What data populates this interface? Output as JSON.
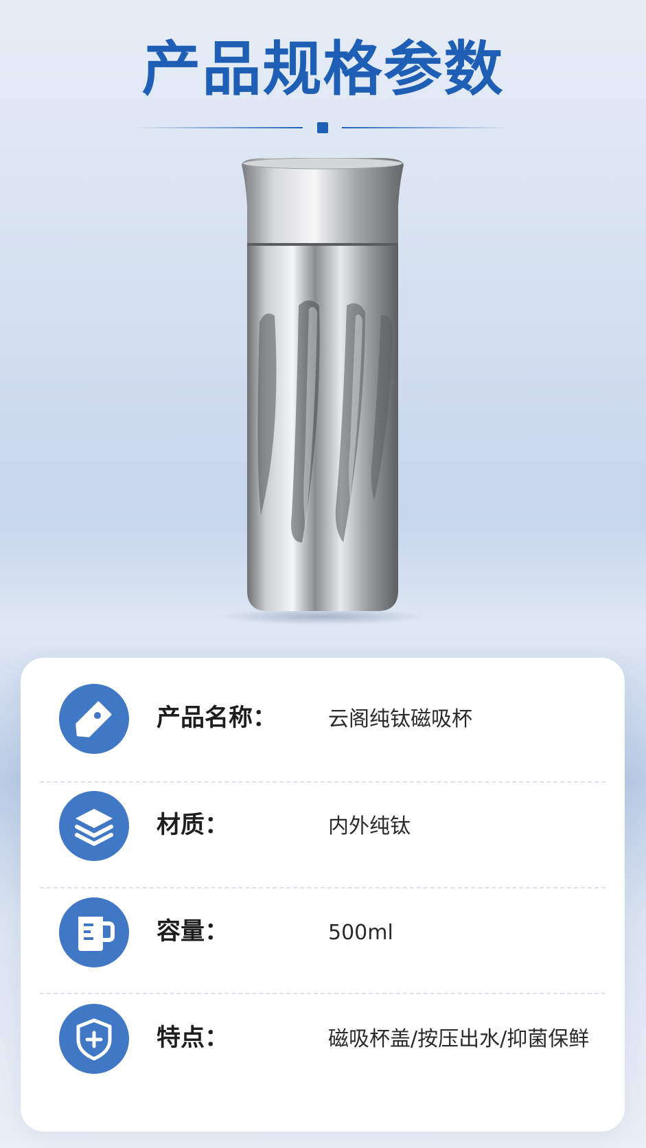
{
  "header": {
    "title": "产品规格参数"
  },
  "colors": {
    "accent": "#1e5fb5",
    "icon_bg": "#4078c6"
  },
  "specs": [
    {
      "icon": "price-tag-icon",
      "label": "产品名称：",
      "value": "云阁纯钛磁吸杯"
    },
    {
      "icon": "layers-icon",
      "label": "材质：",
      "value": "内外纯钛"
    },
    {
      "icon": "measuring-cup-icon",
      "label": "容量：",
      "value": "500ml"
    },
    {
      "icon": "shield-plus-icon",
      "label": "特点：",
      "value": "磁吸杯盖/按压出水/抑菌保鲜"
    }
  ]
}
